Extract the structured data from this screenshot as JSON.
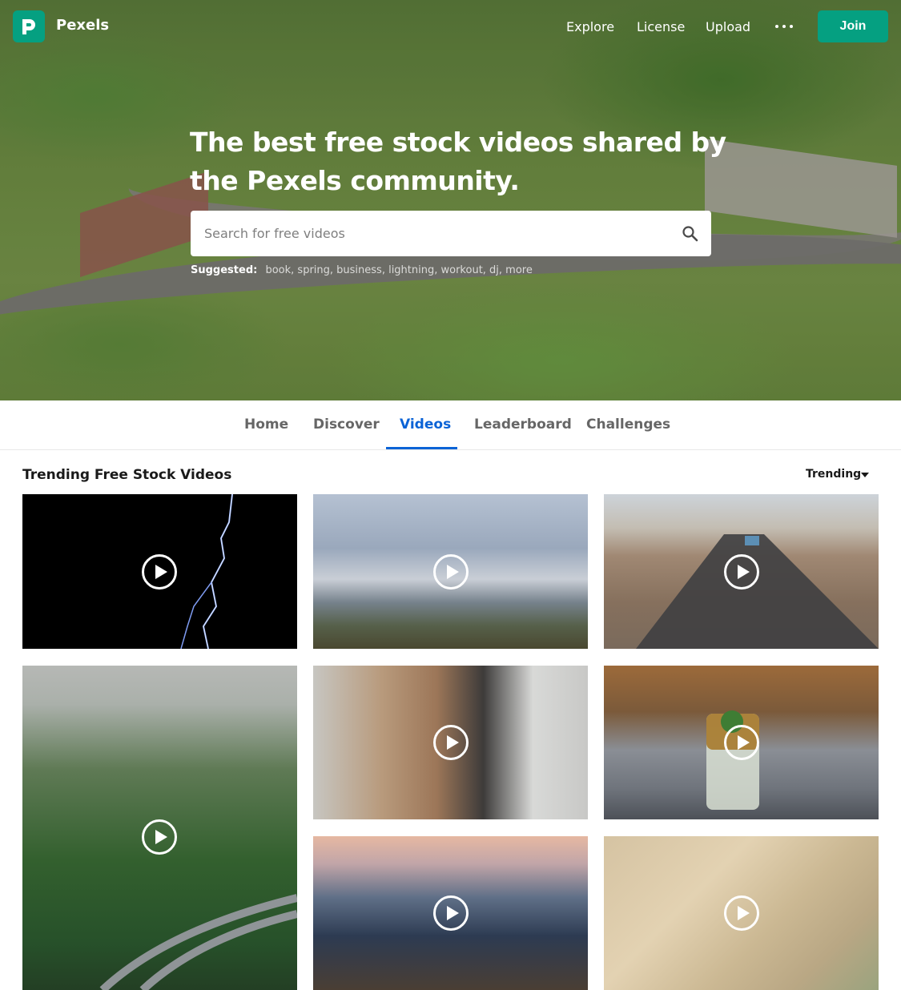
{
  "brand": {
    "name": "Pexels",
    "color": "#05a081"
  },
  "topnav": {
    "links": [
      "Explore",
      "License",
      "Upload"
    ],
    "more_icon": "ellipsis-icon",
    "join_label": "Join"
  },
  "hero": {
    "headline": "The best free stock videos shared by the Pexels community.",
    "search_placeholder": "Search for free videos",
    "search_icon": "search-icon",
    "suggested_label": "Suggested:",
    "suggested_tags": "book, spring, business, lightning, workout, dj, more"
  },
  "tabs": {
    "items": [
      "Home",
      "Discover",
      "Videos",
      "Leaderboard",
      "Challenges"
    ],
    "active": "Videos",
    "active_color": "#0b63d6"
  },
  "section": {
    "title": "Trending Free Stock Videos",
    "sort_value": "Trending"
  },
  "videos": [
    {
      "icon": "play-icon"
    },
    {
      "icon": "play-icon"
    },
    {
      "icon": "play-icon"
    },
    {
      "icon": "play-icon"
    },
    {
      "icon": "play-icon"
    },
    {
      "icon": "play-icon"
    },
    {
      "icon": "play-icon"
    },
    {
      "icon": "play-icon"
    }
  ]
}
